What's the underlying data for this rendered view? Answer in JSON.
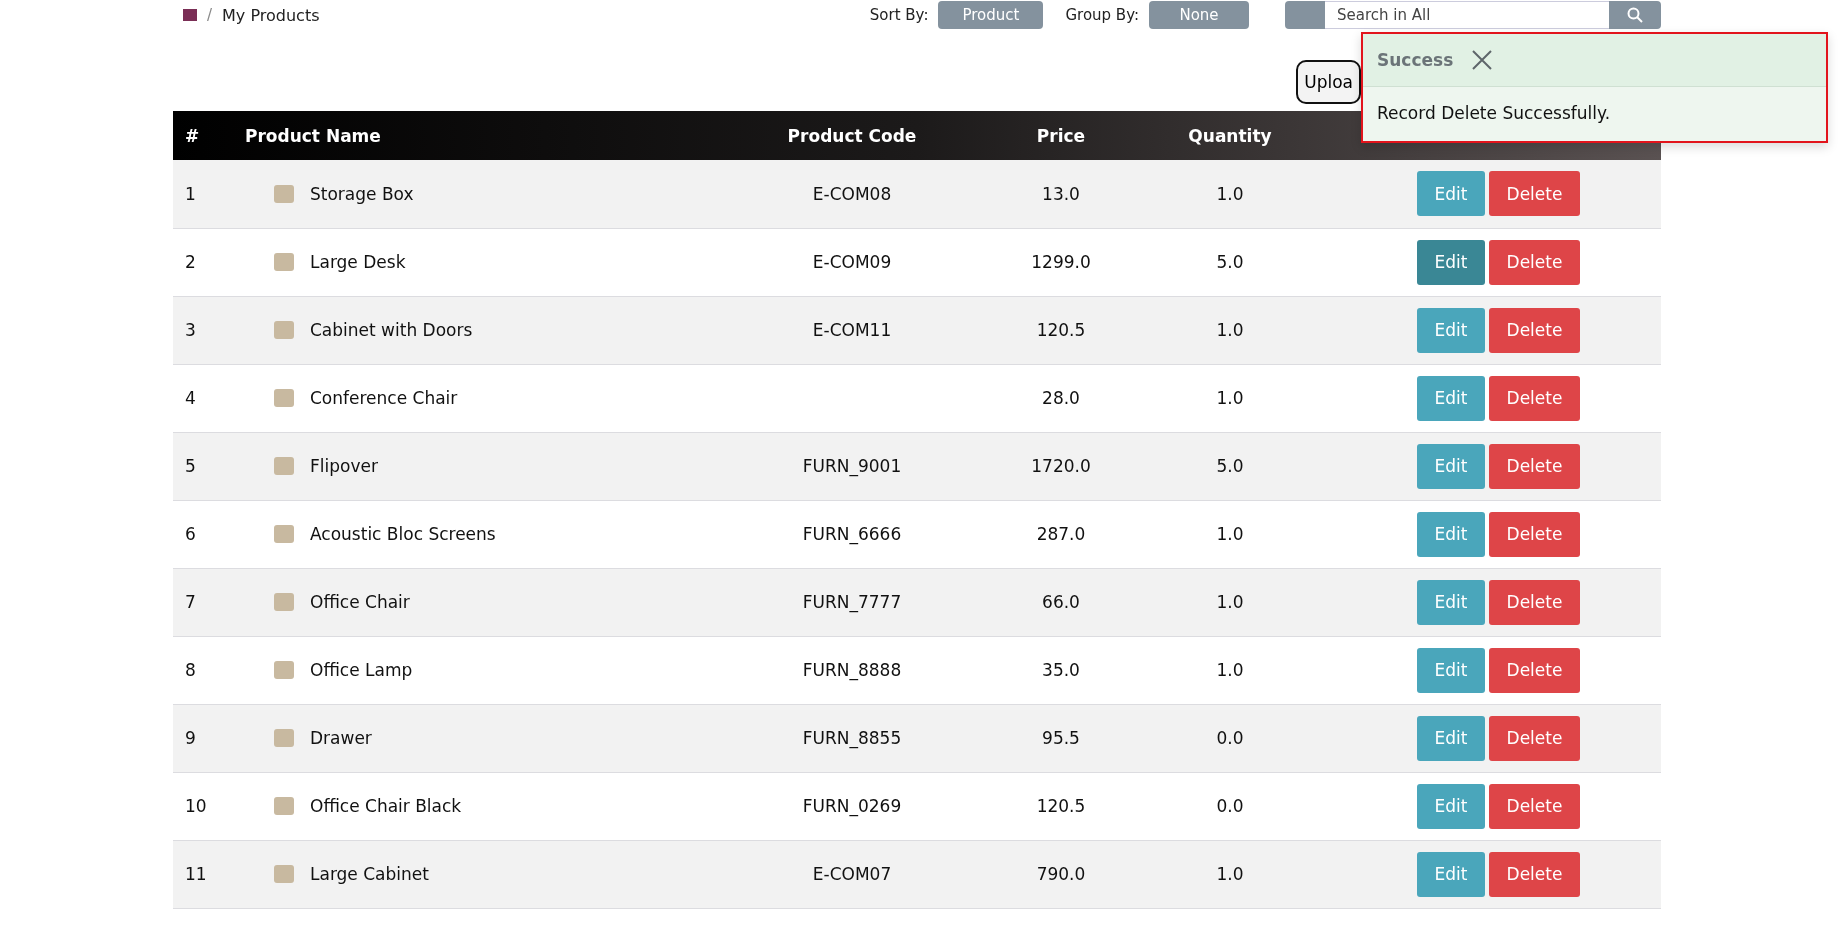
{
  "breadcrumb": {
    "separator": "/",
    "current": "My Products"
  },
  "toolbar": {
    "sort_label": "Sort By:",
    "sort_value": "Product",
    "group_label": "Group By:",
    "group_value": "None",
    "search": {
      "placeholder": "Search in All"
    }
  },
  "upload_button": "Uploa",
  "toast": {
    "title": "Success",
    "message": "Record Delete Successfully."
  },
  "table": {
    "columns": [
      "#",
      "Product Name",
      "Product Code",
      "Price",
      "Quantity"
    ],
    "rows": [
      {
        "index": "1",
        "name": "Storage Box",
        "code": "E-COM08",
        "price": "13.0",
        "quantity": "1.0",
        "edit": "Edit",
        "delete": "Delete",
        "edit_hovered": false
      },
      {
        "index": "2",
        "name": "Large Desk",
        "code": "E-COM09",
        "price": "1299.0",
        "quantity": "5.0",
        "edit": "Edit",
        "delete": "Delete",
        "edit_hovered": true
      },
      {
        "index": "3",
        "name": "Cabinet with Doors",
        "code": "E-COM11",
        "price": "120.5",
        "quantity": "1.0",
        "edit": "Edit",
        "delete": "Delete",
        "edit_hovered": false
      },
      {
        "index": "4",
        "name": "Conference Chair",
        "price": "28.0",
        "quantity": "1.0",
        "edit": "Edit",
        "delete": "Delete",
        "edit_hovered": false
      },
      {
        "index": "5",
        "name": "Flipover",
        "code": "FURN_9001",
        "price": "1720.0",
        "quantity": "5.0",
        "edit": "Edit",
        "delete": "Delete",
        "edit_hovered": false
      },
      {
        "index": "6",
        "name": "Acoustic Bloc Screens",
        "code": "FURN_6666",
        "price": "287.0",
        "quantity": "1.0",
        "edit": "Edit",
        "delete": "Delete",
        "edit_hovered": false
      },
      {
        "index": "7",
        "name": "Office Chair",
        "code": "FURN_7777",
        "price": "66.0",
        "quantity": "1.0",
        "edit": "Edit",
        "delete": "Delete",
        "edit_hovered": false
      },
      {
        "index": "8",
        "name": "Office Lamp",
        "code": "FURN_8888",
        "price": "35.0",
        "quantity": "1.0",
        "edit": "Edit",
        "delete": "Delete",
        "edit_hovered": false
      },
      {
        "index": "9",
        "name": "Drawer",
        "code": "FURN_8855",
        "price": "95.5",
        "quantity": "0.0",
        "edit": "Edit",
        "delete": "Delete",
        "edit_hovered": false
      },
      {
        "index": "10",
        "name": "Office Chair Black",
        "code": "FURN_0269",
        "price": "120.5",
        "quantity": "0.0",
        "edit": "Edit",
        "delete": "Delete",
        "edit_hovered": false
      },
      {
        "index": "11",
        "name": "Large Cabinet",
        "code": "E-COM07",
        "price": "790.0",
        "quantity": "1.0",
        "edit": "Edit",
        "delete": "Delete",
        "edit_hovered": false
      }
    ]
  }
}
